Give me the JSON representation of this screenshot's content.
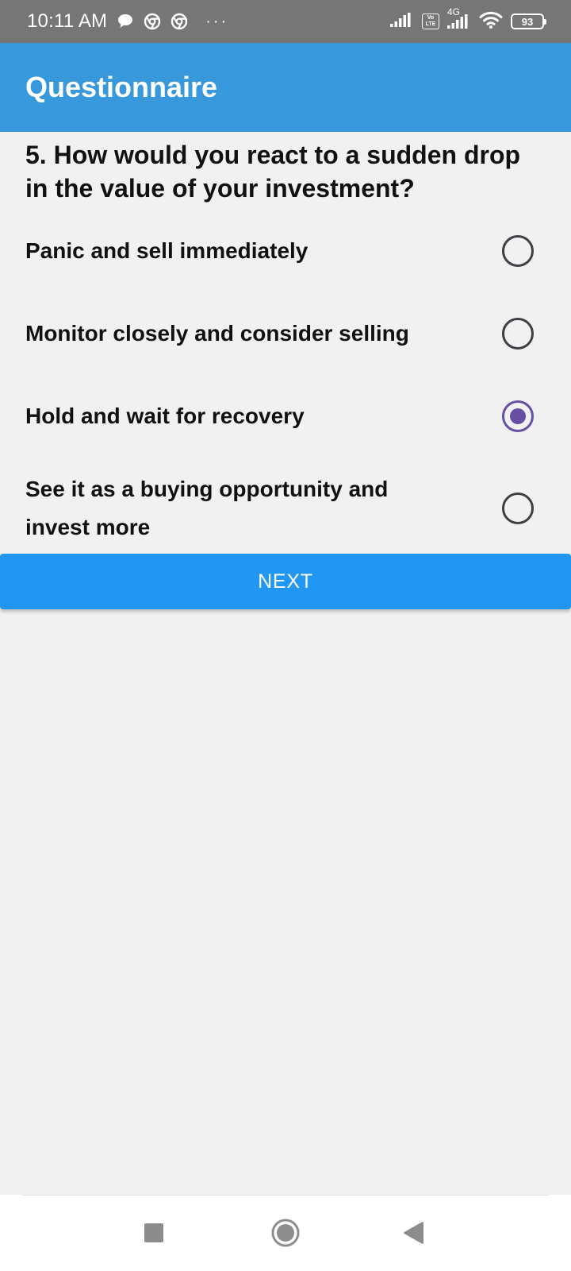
{
  "status_bar": {
    "time": "10:11 AM",
    "notification_icons": [
      "chat-bubble-icon",
      "chrome-icon",
      "chrome-icon"
    ],
    "more_indicator": "···",
    "network_label": "4G",
    "lte_label_top": "Vo",
    "lte_label_bottom": "LTE",
    "battery_level": "93"
  },
  "app_bar": {
    "title": "Questionnaire",
    "color": "#3799dc"
  },
  "question": {
    "text": "5. How would you react to a sudden drop in the value of your investment?",
    "options": [
      {
        "label": "Panic and sell immediately",
        "selected": false
      },
      {
        "label": "Monitor closely and consider selling",
        "selected": false
      },
      {
        "label": "Hold and wait for recovery",
        "selected": true
      },
      {
        "label": "See it as a buying opportunity and invest more",
        "selected": false
      }
    ]
  },
  "next_button": {
    "label": "NEXT",
    "color": "#2196f3"
  },
  "nav_bar": {
    "buttons": [
      "recents-square-icon",
      "home-circle-icon",
      "back-triangle-icon"
    ]
  },
  "colors": {
    "background": "#f1f1f2",
    "radio_selected": "#6750a4",
    "radio_unselected": "#3f3f46"
  }
}
